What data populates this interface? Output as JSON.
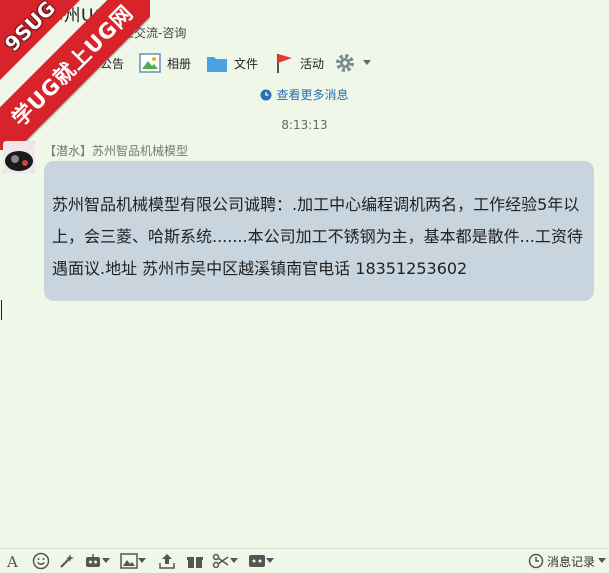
{
  "header": {
    "title": "苏州UG编程",
    "subtitle": "行业交流-咨询"
  },
  "banner": {
    "top_text": "9SUG",
    "ribbon_text": "学UG就上UG网"
  },
  "toolbar": {
    "announcement": "公告",
    "album": "相册",
    "files": "文件",
    "activity": "活动"
  },
  "messages": {
    "view_more": "查看更多消息",
    "timestamp": "8:13:13",
    "sender": "【潜水】苏州智品机械模型",
    "text": "苏州智品机械模型有限公司诚聘：.加工中心编程调机两名，工作经验5年以上，会三菱、哈斯系统.......本公司加工不锈钢为主，基本都是散件...工资待遇面议.地址 苏州市吴中区越溪镇南官电话 18351253602"
  },
  "bottombar": {
    "history": "消息记录"
  },
  "colors": {
    "background": "#eef7e8",
    "bubble": "#c8d4de",
    "link": "#2b6fb3",
    "banner_red": "#d8232a"
  }
}
